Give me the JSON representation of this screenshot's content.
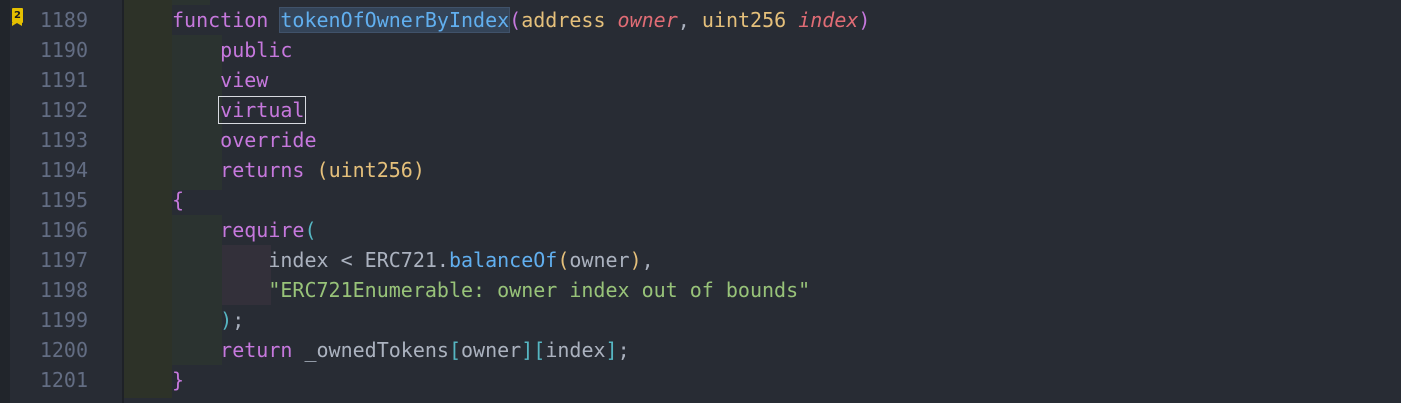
{
  "editor": {
    "bookmark_badge": "2",
    "lines": [
      {
        "number": "1189",
        "tokens": [
          {
            "t": "function",
            "c": "kw"
          },
          {
            "t": " ",
            "c": "pn"
          },
          {
            "t": "tokenOfOwnerByIndex",
            "c": "fn hl-sel"
          },
          {
            "t": "(",
            "c": "b1"
          },
          {
            "t": "address",
            "c": "ty"
          },
          {
            "t": " ",
            "c": "pn"
          },
          {
            "t": "owner",
            "c": "pr"
          },
          {
            "t": ", ",
            "c": "pn"
          },
          {
            "t": "uint256",
            "c": "ty"
          },
          {
            "t": " ",
            "c": "pn"
          },
          {
            "t": "index",
            "c": "pr"
          },
          {
            "t": ")",
            "c": "b1"
          }
        ]
      },
      {
        "number": "1190",
        "tokens": [
          {
            "t": "    ",
            "c": "pn"
          },
          {
            "t": "public",
            "c": "kw"
          }
        ]
      },
      {
        "number": "1191",
        "tokens": [
          {
            "t": "    ",
            "c": "pn"
          },
          {
            "t": "view",
            "c": "kw"
          }
        ]
      },
      {
        "number": "1192",
        "tokens": [
          {
            "t": "    ",
            "c": "pn"
          },
          {
            "t": "virtual",
            "c": "kw hl-box"
          }
        ]
      },
      {
        "number": "1193",
        "tokens": [
          {
            "t": "    ",
            "c": "pn"
          },
          {
            "t": "override",
            "c": "kw"
          }
        ]
      },
      {
        "number": "1194",
        "tokens": [
          {
            "t": "    ",
            "c": "pn"
          },
          {
            "t": "returns",
            "c": "kw"
          },
          {
            "t": " ",
            "c": "pn"
          },
          {
            "t": "(",
            "c": "b3"
          },
          {
            "t": "uint256",
            "c": "ty"
          },
          {
            "t": ")",
            "c": "b3"
          }
        ]
      },
      {
        "number": "1195",
        "tokens": [
          {
            "t": "{",
            "c": "b1"
          }
        ]
      },
      {
        "number": "1196",
        "tokens": [
          {
            "t": "    ",
            "c": "pn"
          },
          {
            "t": "require",
            "c": "kw"
          },
          {
            "t": "(",
            "c": "b2"
          }
        ]
      },
      {
        "number": "1197",
        "tokens": [
          {
            "t": "        ",
            "c": "pn"
          },
          {
            "t": "index",
            "c": "pn"
          },
          {
            "t": " < ",
            "c": "pn"
          },
          {
            "t": "ERC721",
            "c": "pn"
          },
          {
            "t": ".",
            "c": "pn"
          },
          {
            "t": "balanceOf",
            "c": "fn"
          },
          {
            "t": "(",
            "c": "b3"
          },
          {
            "t": "owner",
            "c": "pn"
          },
          {
            "t": ")",
            "c": "b3"
          },
          {
            "t": ",",
            "c": "pn"
          }
        ]
      },
      {
        "number": "1198",
        "tokens": [
          {
            "t": "        ",
            "c": "pn"
          },
          {
            "t": "\"ERC721Enumerable: owner index out of bounds\"",
            "c": "st"
          }
        ]
      },
      {
        "number": "1199",
        "tokens": [
          {
            "t": "    ",
            "c": "pn"
          },
          {
            "t": ")",
            "c": "b2"
          },
          {
            "t": ";",
            "c": "pn"
          }
        ]
      },
      {
        "number": "1200",
        "tokens": [
          {
            "t": "    ",
            "c": "pn"
          },
          {
            "t": "return",
            "c": "kw"
          },
          {
            "t": " _ownedTokens",
            "c": "pn"
          },
          {
            "t": "[",
            "c": "b2"
          },
          {
            "t": "owner",
            "c": "pn"
          },
          {
            "t": "]",
            "c": "b2"
          },
          {
            "t": "[",
            "c": "b2"
          },
          {
            "t": "index",
            "c": "pn"
          },
          {
            "t": "]",
            "c": "b2"
          },
          {
            "t": ";",
            "c": "pn"
          }
        ]
      },
      {
        "number": "1201",
        "tokens": [
          {
            "t": "}",
            "c": "b1"
          }
        ]
      }
    ]
  }
}
